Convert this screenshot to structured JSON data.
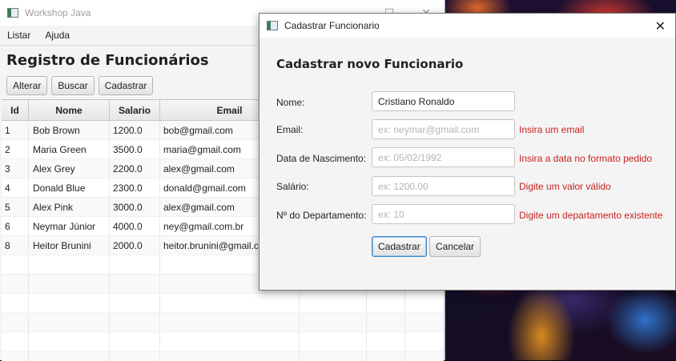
{
  "main_window": {
    "title": "Workshop Java",
    "menu": [
      "Listar",
      "Ajuda"
    ],
    "heading": "Registro de Funcionários",
    "toolbar": {
      "alterar": "Alterar",
      "buscar": "Buscar",
      "cadastrar": "Cadastrar"
    },
    "table": {
      "columns": [
        "Id",
        "Nome",
        "Salario",
        "Email",
        "",
        "",
        ""
      ],
      "rows": [
        [
          "1",
          "Bob Brown",
          "1200.0",
          "bob@gmail.com"
        ],
        [
          "2",
          "Maria Green",
          "3500.0",
          "maria@gmail.com"
        ],
        [
          "3",
          "Alex Grey",
          "2200.0",
          "alex@gmail.com"
        ],
        [
          "4",
          "Donald Blue",
          "2300.0",
          "donald@gmail.com"
        ],
        [
          "5",
          "Alex Pink",
          "3000.0",
          "alex@gmail.com"
        ],
        [
          "6",
          "Neymar Júnior",
          "4000.0",
          "ney@gmail.com.br"
        ],
        [
          "8",
          "Heitor Brunini",
          "2000.0",
          "heitor.brunini@gmail.com"
        ]
      ]
    }
  },
  "dialog": {
    "title": "Cadastrar Funcionario",
    "heading": "Cadastrar novo Funcionario",
    "fields": {
      "nome": {
        "label": "Nome:",
        "value": "Cristiano Ronaldo",
        "placeholder": "",
        "error": ""
      },
      "email": {
        "label": "Email:",
        "value": "",
        "placeholder": "ex: neymar@gmail.com",
        "error": "Insira um email"
      },
      "nascimento": {
        "label": "Data de Nascimento:",
        "value": "",
        "placeholder": "ex: 05/02/1992",
        "error": "Insira a data no formato pedido"
      },
      "salario": {
        "label": "Salário:",
        "value": "",
        "placeholder": "ex: 1200.00",
        "error": "Digite um valor válido"
      },
      "departamento": {
        "label": "Nº do Departamento:",
        "value": "",
        "placeholder": "ex: 10",
        "error": "Digite um departamento existente"
      }
    },
    "buttons": {
      "cadastrar": "Cadastrar",
      "cancelar": "Cancelar"
    }
  },
  "colors": {
    "error": "#cc1f1f",
    "focus_border": "#3f86c8"
  }
}
